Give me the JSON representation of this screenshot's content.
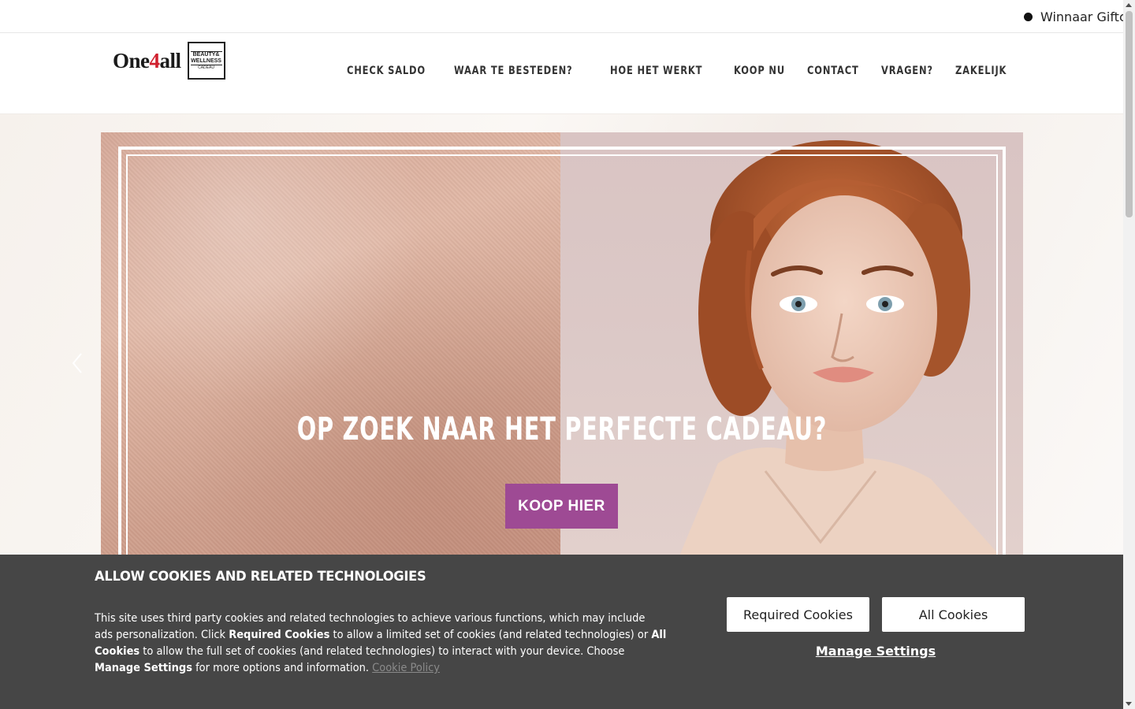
{
  "ticker": {
    "text": "Winnaar Giftcard"
  },
  "logo": {
    "brand_prefix": "One",
    "brand_four": "4",
    "brand_suffix": "all",
    "line1": "BEAUTY&",
    "line2": "WELLNESS",
    "line3": "CADEAU"
  },
  "nav": {
    "items": [
      {
        "label": "CHECK SALDO"
      },
      {
        "label": "WAAR TE BESTEDEN?"
      },
      {
        "label": "HOE HET WERKT"
      },
      {
        "label": "KOOP NU"
      },
      {
        "label": "CONTACT"
      },
      {
        "label": "VRAGEN?"
      },
      {
        "label": "ZAKELIJK"
      }
    ]
  },
  "hero": {
    "title": "OP ZOEK NAAR HET PERFECTE CADEAU?",
    "cta_label": "KOOP HIER",
    "cta_color": "#9e4a94",
    "prev_icon": "chevron-left-icon"
  },
  "cookie": {
    "title": "ALLOW COOKIES AND RELATED TECHNOLOGIES",
    "text_1": "This site uses third party cookies and related technologies to achieve various functions, which may include ads personalization. Click ",
    "text_b1": "Required Cookies",
    "text_2": " to allow a limited set of cookies (and related technologies) or ",
    "text_b2": "All Cookies",
    "text_3": " to allow the full set of cookies (and related technologies) to interact with your device. Choose ",
    "text_b3": "Manage Settings",
    "text_4": " for more options and information. ",
    "policy_link": "Cookie Policy",
    "required_button": "Required Cookies",
    "all_button": "All Cookies",
    "manage_link": "Manage Settings",
    "background": "#464646"
  }
}
